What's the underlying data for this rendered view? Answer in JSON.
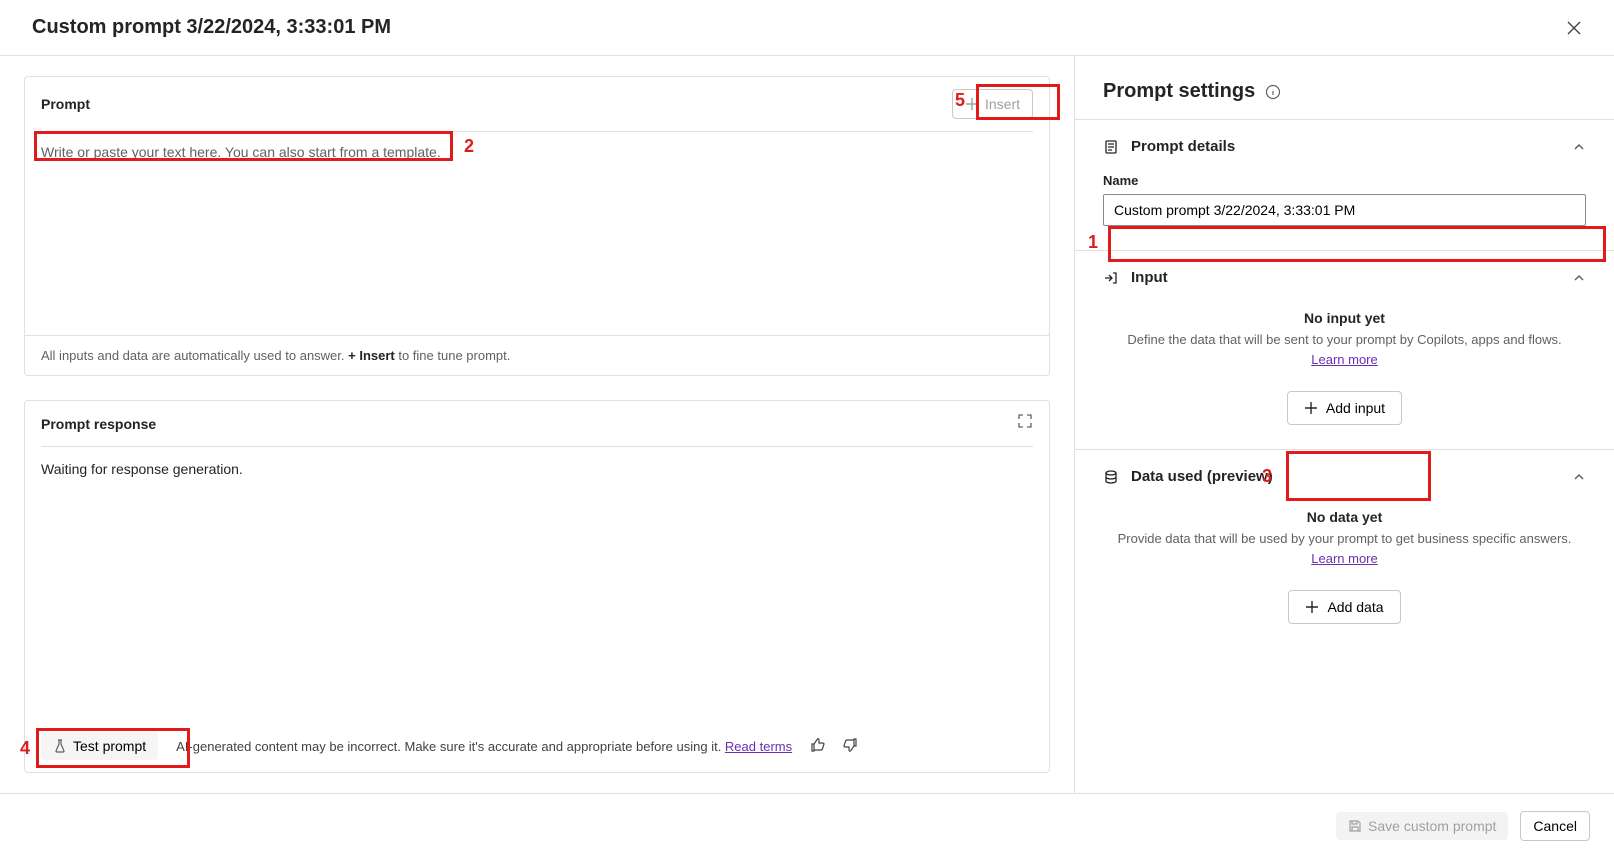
{
  "header": {
    "title": "Custom prompt 3/22/2024, 3:33:01 PM"
  },
  "prompt_card": {
    "title": "Prompt",
    "insert_label": "Insert",
    "placeholder_pre": "Write or paste your text here. You can also ",
    "placeholder_link": "start from a template",
    "placeholder_post": ".",
    "helper_pre": "All inputs and data are automatically used to answer. ",
    "helper_bold": "+ Insert",
    "helper_post": " to fine tune prompt."
  },
  "response_card": {
    "title": "Prompt response",
    "body": "Waiting for response generation.",
    "test_label": "Test prompt",
    "disclaimer": "AI-generated content may be incorrect. Make sure it's accurate and appropriate before using it. ",
    "terms_link": "Read terms"
  },
  "settings": {
    "title": "Prompt settings",
    "details": {
      "title": "Prompt details",
      "name_label": "Name",
      "name_value": "Custom prompt 3/22/2024, 3:33:01 PM"
    },
    "input": {
      "title": "Input",
      "empty_title": "No input yet",
      "empty_desc": "Define the data that will be sent to your prompt by Copilots, apps and flows.",
      "learn": "Learn more",
      "add_label": "Add input"
    },
    "data": {
      "title": "Data used (preview)",
      "empty_title": "No data yet",
      "empty_desc": "Provide data that will be used by your prompt to get business specific answers.",
      "learn": "Learn more",
      "add_label": "Add data"
    }
  },
  "footer": {
    "save": "Save custom prompt",
    "cancel": "Cancel"
  },
  "annotations": {
    "n1": "1",
    "n2": "2",
    "n3": "3",
    "n4": "4",
    "n5": "5"
  }
}
